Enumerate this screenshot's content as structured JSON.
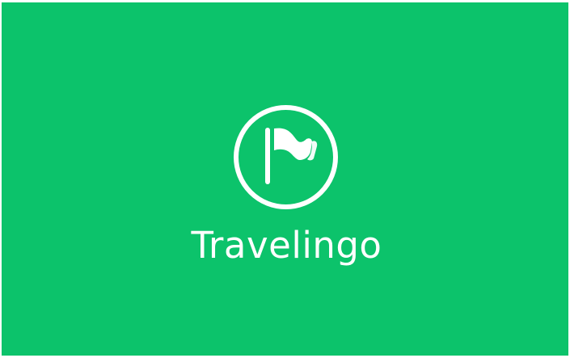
{
  "app": {
    "name": "Travelingo",
    "logo_icon": "flag-in-circle-icon"
  },
  "colors": {
    "background": "#0cc36b",
    "foreground": "#ffffff",
    "border": "#ffffff"
  }
}
